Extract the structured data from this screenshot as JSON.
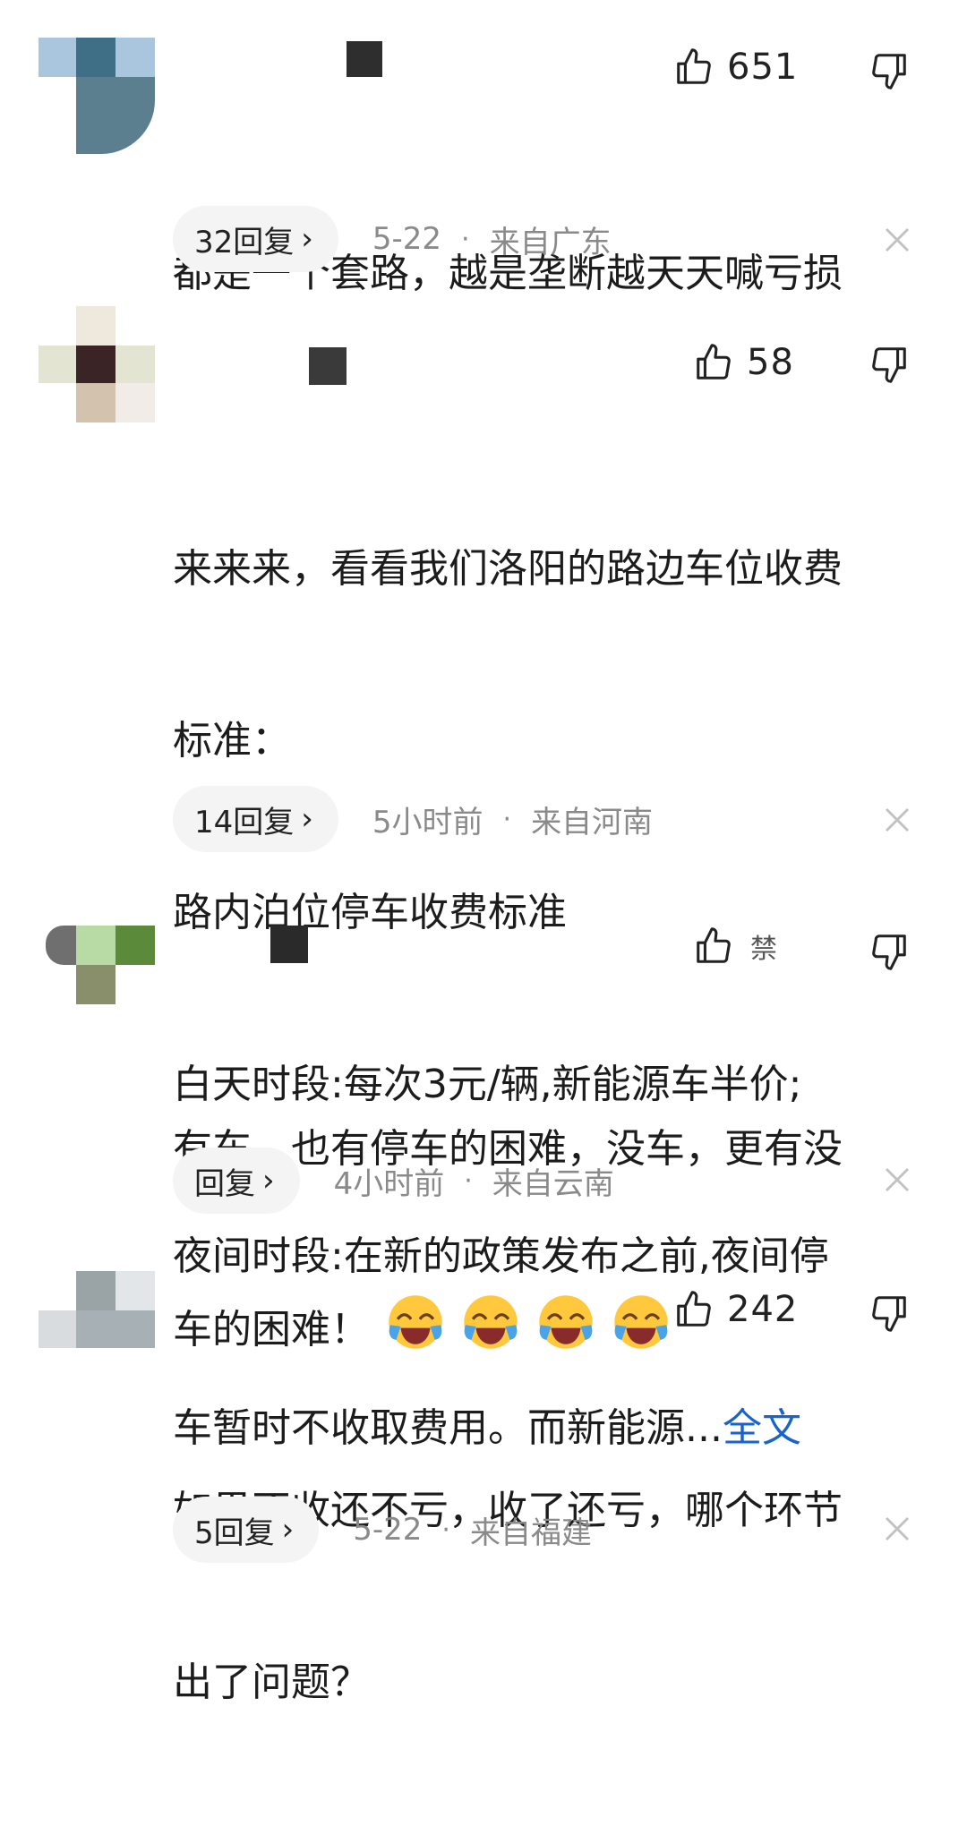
{
  "comments": [
    {
      "likes": "651",
      "content_lines": [
        "都是一个套路，越是垄断越天天喊亏损"
      ],
      "reply_label": "32回复",
      "date": "5-22",
      "location": "来自广东"
    },
    {
      "likes": "58",
      "content_lines": [
        "来来来，看看我们洛阳的路边车位收费",
        "标准：",
        "路内泊位停车收费标准",
        " 白天时段:每次3元/辆,新能源车半价;",
        " 夜间时段:在新的政策发布之前,夜间停",
        "车暂时不收取费用。而新能源..."
      ],
      "full_text_link": "全文",
      "reply_label": "14回复",
      "date": "5小时前",
      "location": "来自河南"
    },
    {
      "likes": "禁",
      "content_lines": [
        "有车，也有停车的困难，没车，更有没",
        "车的困难！"
      ],
      "emoji_count": 4,
      "reply_label": "回复",
      "date": "4小时前",
      "location": "来自云南"
    },
    {
      "likes": "242",
      "content_lines": [
        "如果不收还不亏，收了还亏，哪个环节",
        "出了问题？"
      ],
      "reply_label": "5回复",
      "date": "5-22",
      "location": "来自福建"
    }
  ],
  "separator": "·",
  "chevron": "›",
  "icons": {
    "like": "thumbs-up-icon",
    "dislike": "thumbs-down-icon",
    "close": "close-icon",
    "emoji": "laughing-crying-emoji-icon"
  },
  "colors": {
    "link": "#1a63c9",
    "meta": "#8a8a8a",
    "pill": "#f4f4f4"
  }
}
